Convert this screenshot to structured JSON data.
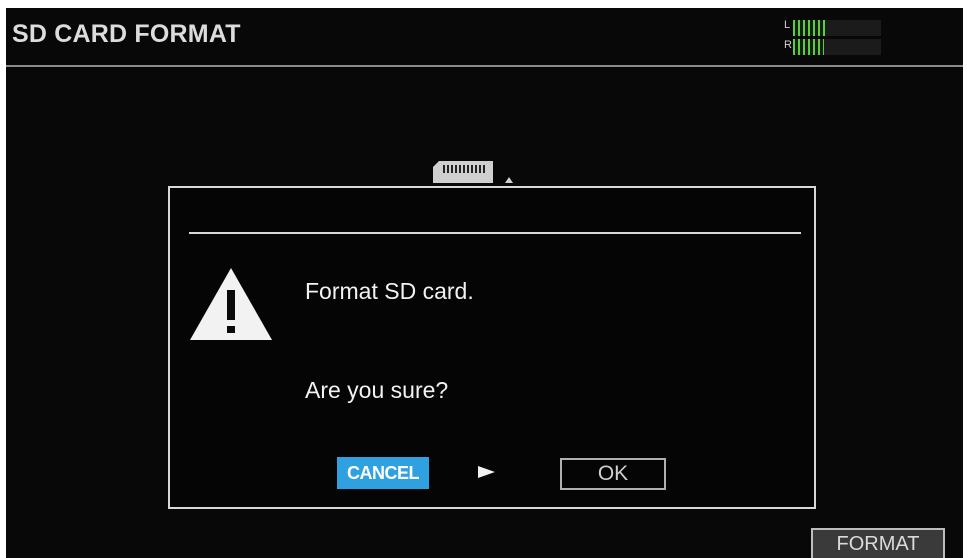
{
  "header": {
    "title": "SD CARD FORMAT",
    "meter": {
      "left_label": "L",
      "right_label": "R",
      "left_level": 0.38,
      "right_level": 0.35,
      "color": "#57d23a"
    }
  },
  "background_icon": "sd-card-icon",
  "dialog": {
    "icon": "warning-icon",
    "line1": "Format SD card.",
    "line2": "Are you sure?",
    "cancel_label": "CANCEL",
    "arrow_icon": "right-arrow-icon",
    "ok_label": "OK",
    "selected_button": "CANCEL",
    "accent_color": "#2fa0e0"
  },
  "footer": {
    "format_label": "FORMAT"
  }
}
